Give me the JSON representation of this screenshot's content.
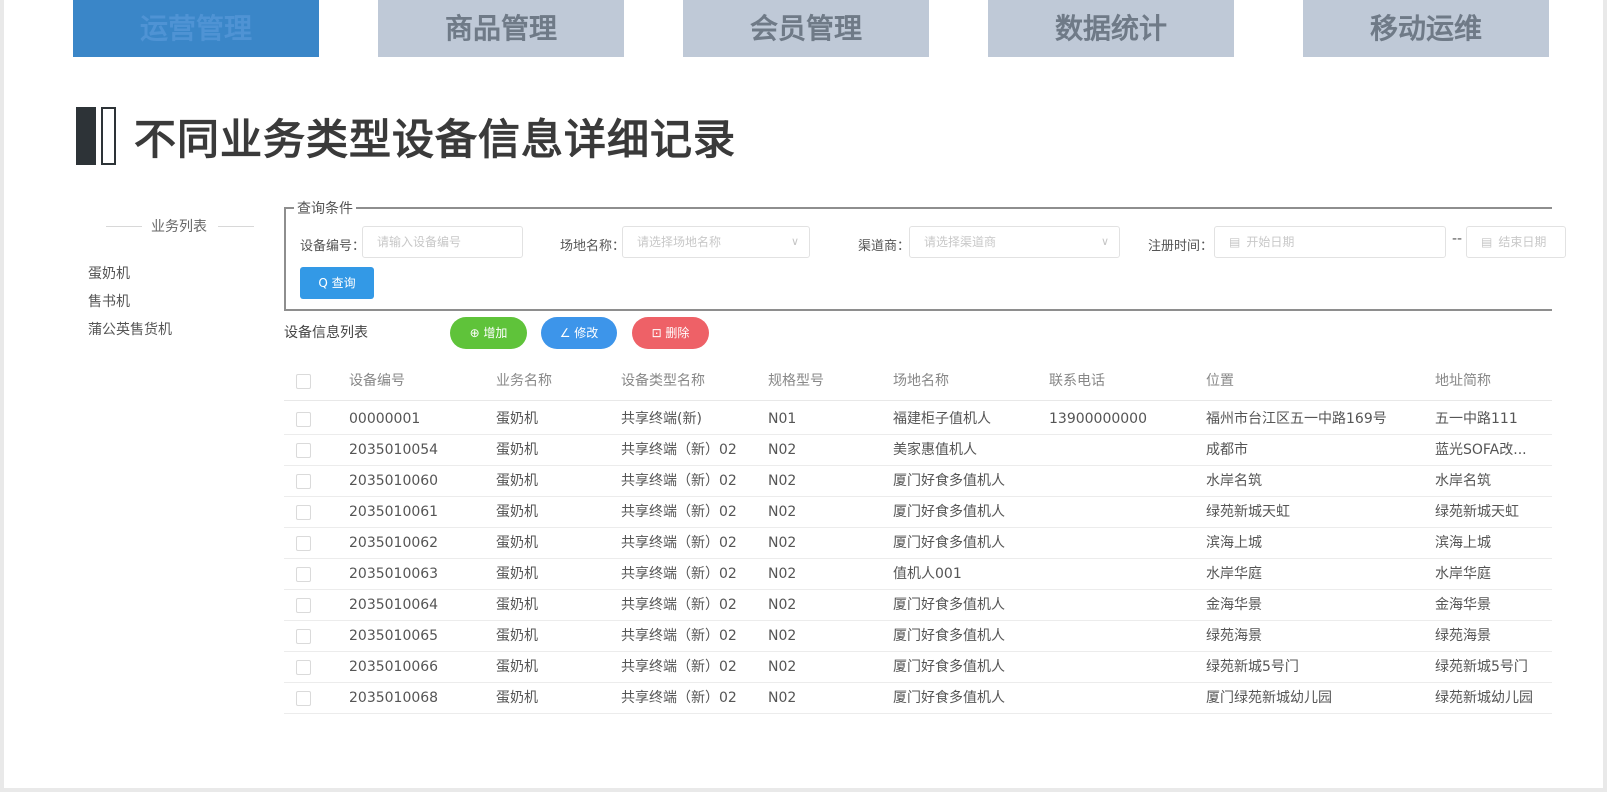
{
  "tabs": [
    {
      "label": "运营管理",
      "active": true
    },
    {
      "label": "商品管理",
      "active": false
    },
    {
      "label": "会员管理",
      "active": false
    },
    {
      "label": "数据统计",
      "active": false
    },
    {
      "label": "移动运维",
      "active": false
    }
  ],
  "heading": "不同业务类型设备信息详细记录",
  "sidebar": {
    "title": "业务列表",
    "items": [
      "蛋奶机",
      "售书机",
      "蒲公英售货机"
    ]
  },
  "query": {
    "legend": "查询条件",
    "device_label": "设备编号：",
    "device_placeholder": "请输入设备编号",
    "venue_label": "场地名称：",
    "venue_placeholder": "请选择场地名称",
    "channel_label": "渠道商：",
    "channel_placeholder": "请选择渠道商",
    "reg_label": "注册时间：",
    "start_placeholder": "开始日期",
    "range_sep": "--",
    "end_placeholder": "结束日期",
    "search_label": "Q 查询"
  },
  "list": {
    "title": "设备信息列表",
    "add_label": "⊕ 增加",
    "edit_label": "∠ 修改",
    "delete_label": "⊡ 删除"
  },
  "table": {
    "columns": [
      "设备编号",
      "业务名称",
      "设备类型名称",
      "规格型号",
      "场地名称",
      "联系电话",
      "位置",
      "地址简称"
    ],
    "rows": [
      [
        "00000001",
        "蛋奶机",
        "共享终端(新)",
        "N01",
        "福建柜子值机人",
        "13900000000",
        "福州市台江区五一中路169号",
        "五一中路111"
      ],
      [
        "2035010054",
        "蛋奶机",
        "共享终端（新）02",
        "N02",
        "美家惠值机人",
        "",
        "成都市",
        "蓝光SOFA改..."
      ],
      [
        "2035010060",
        "蛋奶机",
        "共享终端（新）02",
        "N02",
        "厦门好食多值机人",
        "",
        "水岸名筑",
        "水岸名筑"
      ],
      [
        "2035010061",
        "蛋奶机",
        "共享终端（新）02",
        "N02",
        "厦门好食多值机人",
        "",
        "绿苑新城天虹",
        "绿苑新城天虹"
      ],
      [
        "2035010062",
        "蛋奶机",
        "共享终端（新）02",
        "N02",
        "厦门好食多值机人",
        "",
        "滨海上城",
        "滨海上城"
      ],
      [
        "2035010063",
        "蛋奶机",
        "共享终端（新）02",
        "N02",
        "值机人001",
        "",
        "水岸华庭",
        "水岸华庭"
      ],
      [
        "2035010064",
        "蛋奶机",
        "共享终端（新）02",
        "N02",
        "厦门好食多值机人",
        "",
        "金海华景",
        "金海华景"
      ],
      [
        "2035010065",
        "蛋奶机",
        "共享终端（新）02",
        "N02",
        "厦门好食多值机人",
        "",
        "绿苑海景",
        "绿苑海景"
      ],
      [
        "2035010066",
        "蛋奶机",
        "共享终端（新）02",
        "N02",
        "厦门好食多值机人",
        "",
        "绿苑新城5号门",
        "绿苑新城5号门"
      ],
      [
        "2035010068",
        "蛋奶机",
        "共享终端（新）02",
        "N02",
        "厦门好食多值机人",
        "",
        "厦门绿苑新城幼儿园",
        "绿苑新城幼儿园"
      ]
    ]
  }
}
